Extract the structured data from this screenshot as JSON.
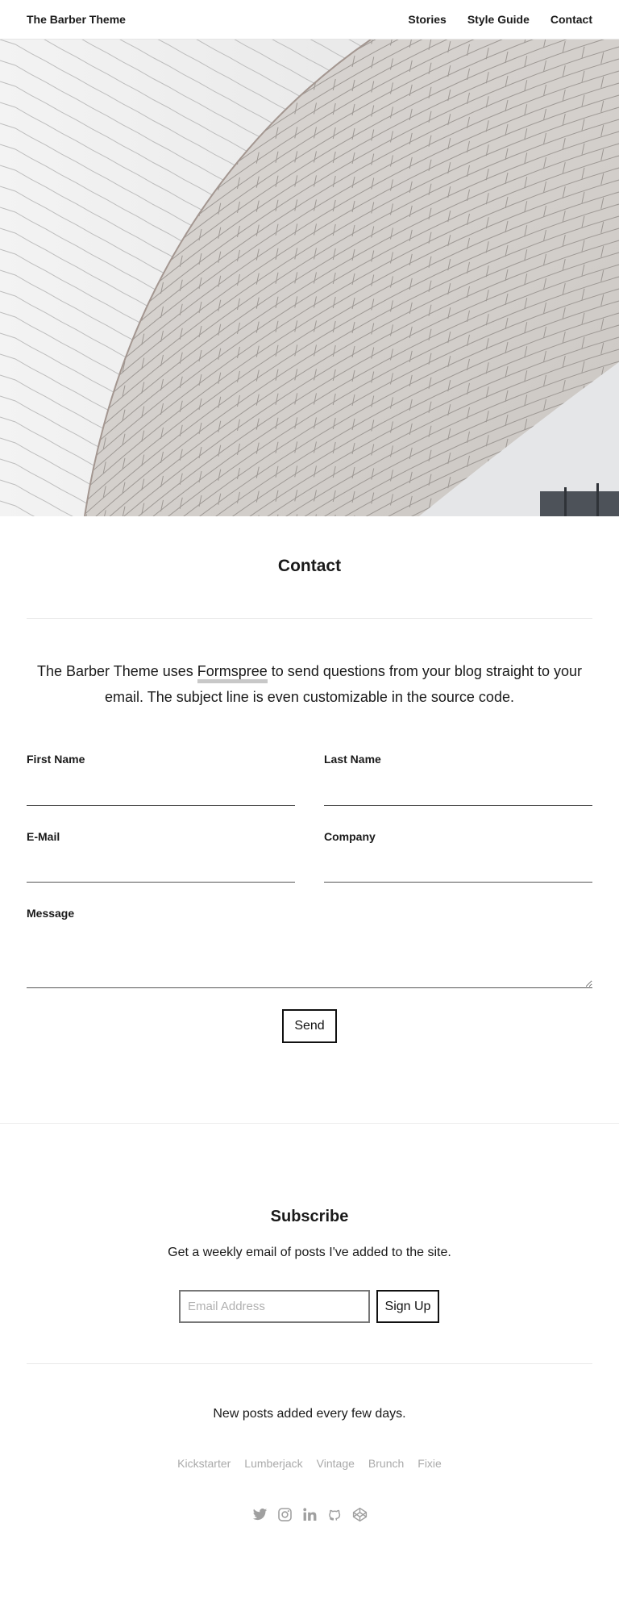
{
  "header": {
    "brand": "The Barber Theme",
    "nav": [
      {
        "label": "Stories"
      },
      {
        "label": "Style Guide"
      },
      {
        "label": "Contact"
      }
    ]
  },
  "page": {
    "title": "Contact",
    "intro_before": "The Barber Theme uses ",
    "intro_link": "Formspree",
    "intro_after": " to send questions from your blog straight to your email. The subject line is even customizable in the source code."
  },
  "form": {
    "first_name_label": "First Name",
    "first_name_value": "",
    "last_name_label": "Last Name",
    "last_name_value": "",
    "email_label": "E-Mail",
    "email_value": "",
    "company_label": "Company",
    "company_value": "",
    "message_label": "Message",
    "message_value": "",
    "submit_label": "Send"
  },
  "subscribe": {
    "title": "Subscribe",
    "description": "Get a weekly email of posts I've added to the site.",
    "placeholder": "Email Address",
    "value": "",
    "button_label": "Sign Up"
  },
  "footer": {
    "note": "New posts added every few days.",
    "tags": [
      "Kickstarter",
      "Lumberjack",
      "Vintage",
      "Brunch",
      "Fixie"
    ],
    "social_icons": [
      "twitter-icon",
      "instagram-icon",
      "linkedin-icon",
      "github-icon",
      "codepen-icon"
    ],
    "icon_color": "#a0a0a0"
  }
}
